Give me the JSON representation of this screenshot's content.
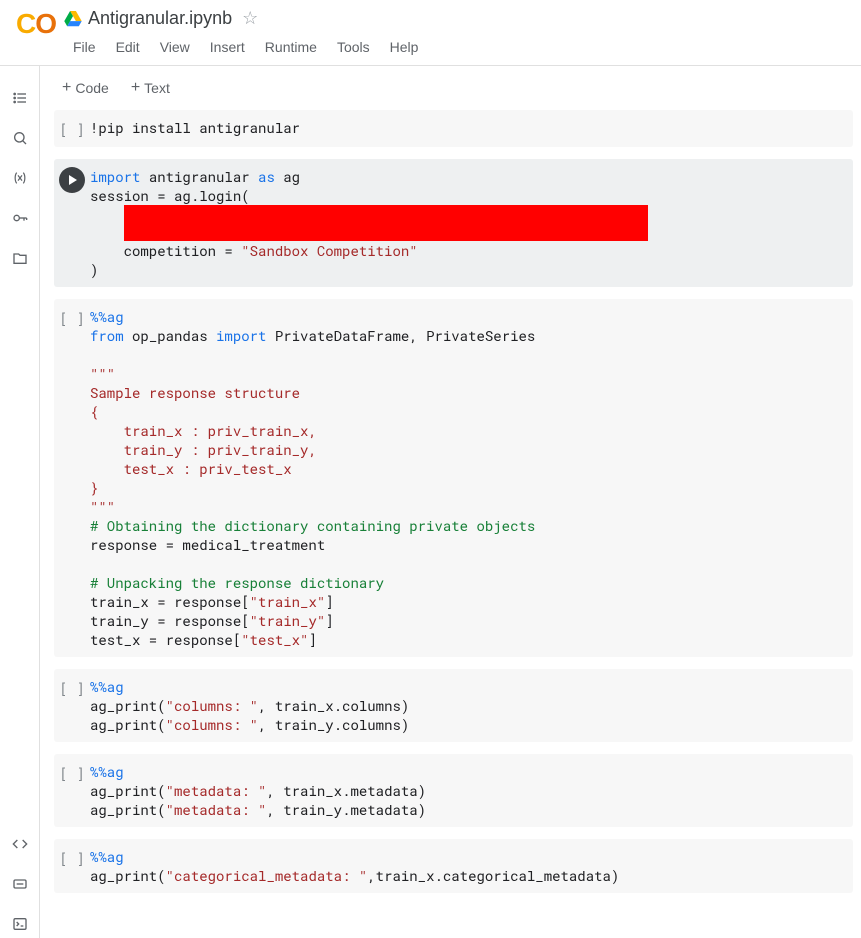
{
  "header": {
    "logo_c": "C",
    "logo_o": "O",
    "title": "Antigranular.ipynb"
  },
  "menu": {
    "file": "File",
    "edit": "Edit",
    "view": "View",
    "insert": "Insert",
    "runtime": "Runtime",
    "tools": "Tools",
    "help": "Help"
  },
  "toolbar": {
    "code": "Code",
    "text": "Text"
  },
  "cells": {
    "c0": {
      "bracket": "[ ]",
      "line0": "!pip install antigranular"
    },
    "c1": {
      "l0_kw_import": "import",
      "l0_mod": " antigranular ",
      "l0_kw_as": "as",
      "l0_alias": " ag",
      "l1": "session = ag.login(",
      "l3_a": "    competition = ",
      "l3_str": "\"Sandbox Competition\"",
      "l4": ")"
    },
    "c2": {
      "mag": "%%ag",
      "l1_from": "from",
      "l1_mod": " op_pandas ",
      "l1_import": "import",
      "l1_rest": " PrivateDataFrame, PrivateSeries",
      "l3": "\"\"\"",
      "l4": "Sample response structure",
      "l5": "{",
      "l6": "    train_x : priv_train_x,",
      "l7": "    train_y : priv_train_y,",
      "l8": "    test_x : priv_test_x",
      "l9": "}",
      "l10": "\"\"\"",
      "l11_cmt": "# Obtaining the dictionary containing private objects",
      "l12": "response = medical_treatment",
      "l14_cmt": "# Unpacking the response dictionary",
      "l15a": "train_x = response[",
      "l15s": "\"train_x\"",
      "l15b": "]",
      "l16a": "train_y = response[",
      "l16s": "\"train_y\"",
      "l16b": "]",
      "l17a": "test_x = response[",
      "l17s": "\"test_x\"",
      "l17b": "]"
    },
    "c3": {
      "mag": "%%ag",
      "l1a": "ag_print(",
      "l1s": "\"columns: \"",
      "l1b": ", train_x.columns)",
      "l2a": "ag_print(",
      "l2s": "\"columns: \"",
      "l2b": ", train_y.columns)"
    },
    "c4": {
      "mag": "%%ag",
      "l1a": "ag_print(",
      "l1s": "\"metadata: \"",
      "l1b": ", train_x.metadata)",
      "l2a": "ag_print(",
      "l2s": "\"metadata: \"",
      "l2b": ", train_y.metadata)"
    },
    "c5": {
      "mag": "%%ag",
      "l1a": "ag_print(",
      "l1s": "\"categorical_metadata: \"",
      "l1b": ",train_x.categorical_metadata)"
    }
  }
}
